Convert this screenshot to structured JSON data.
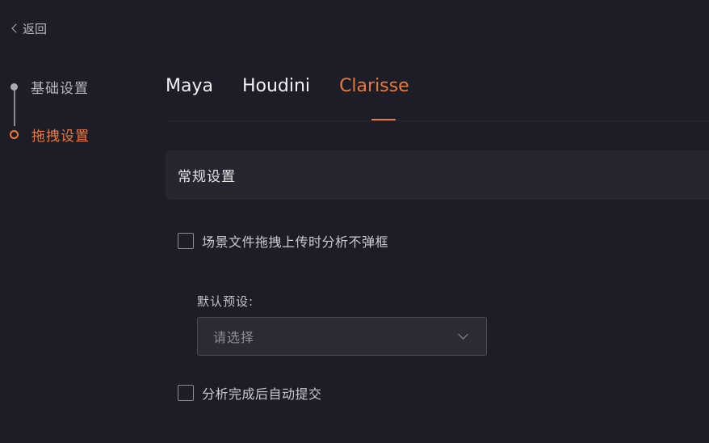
{
  "nav": {
    "back_label": "返回"
  },
  "steps": [
    {
      "label": "基础设置",
      "state": "completed"
    },
    {
      "label": "拖拽设置",
      "state": "active"
    }
  ],
  "tabs": [
    {
      "label": "Maya",
      "active": false
    },
    {
      "label": "Houdini",
      "active": false
    },
    {
      "label": "Clarisse",
      "active": true
    }
  ],
  "section": {
    "title": "常规设置"
  },
  "options": {
    "no_popup_on_drag_upload": {
      "label": "场景文件拖拽上传时分析不弹框",
      "checked": false
    },
    "auto_submit_after_analysis": {
      "label": "分析完成后自动提交",
      "checked": false
    }
  },
  "preset": {
    "label": "默认预设:",
    "placeholder": "请选择"
  },
  "colors": {
    "accent": "#ea7a3c",
    "background": "#1d1d27",
    "panel": "#262631"
  }
}
